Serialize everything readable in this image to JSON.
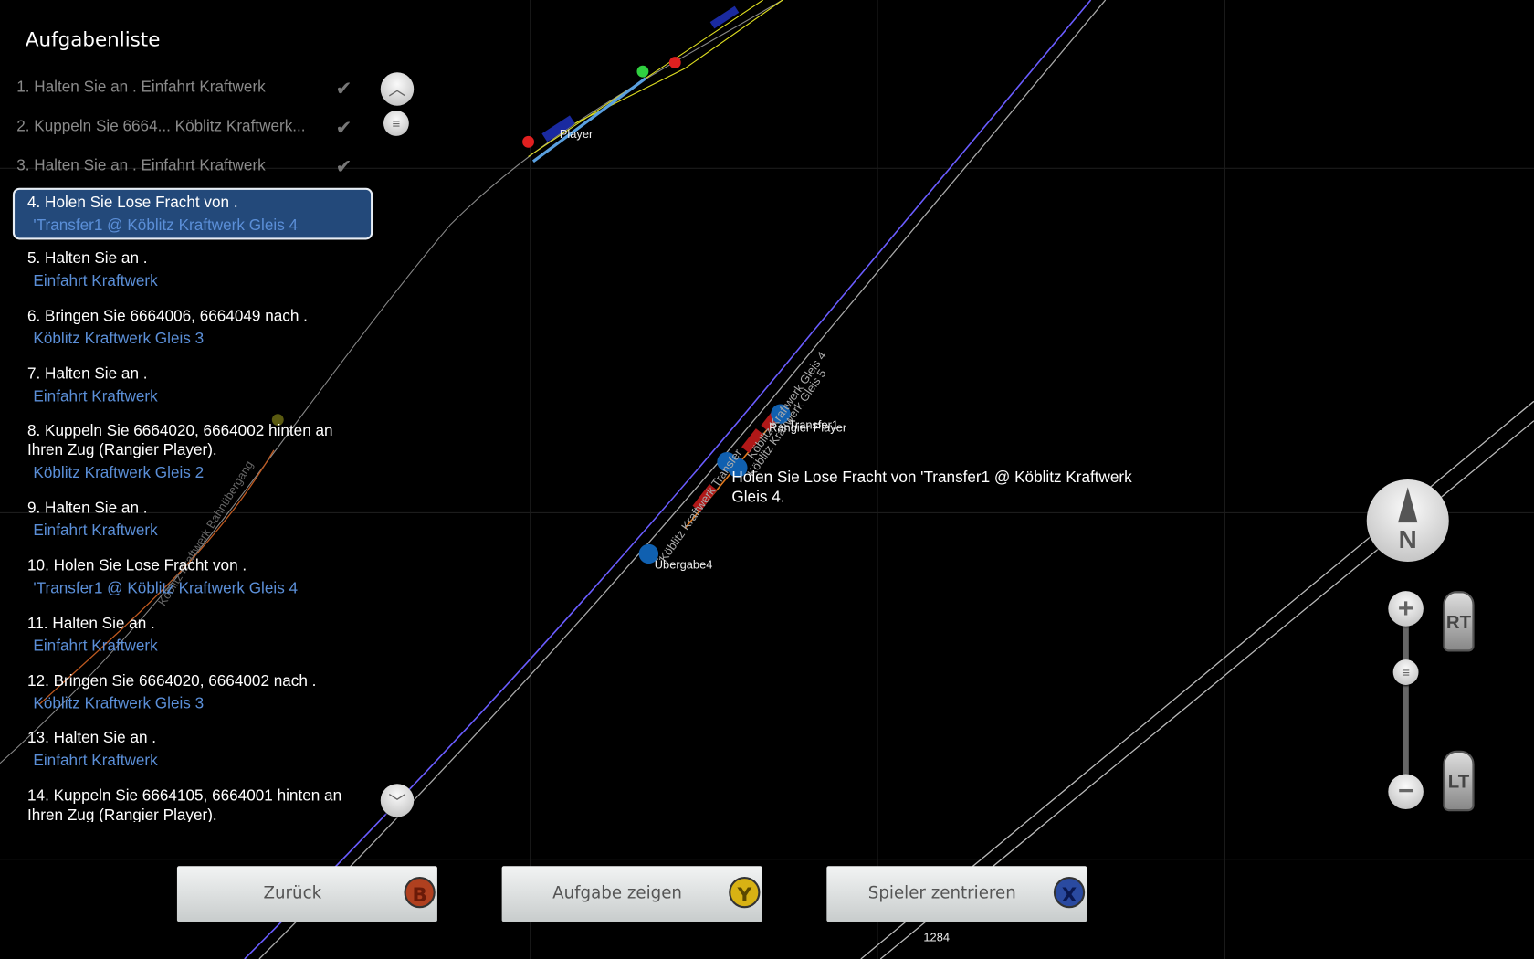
{
  "panel": {
    "title": "Aufgabenliste",
    "completed": [
      {
        "label": "1. Halten Sie an  . Einfahrt Kraftwerk"
      },
      {
        "label": "2. Kuppeln Sie 6664... Köblitz Kraftwerk..."
      },
      {
        "label": "3. Halten Sie an  . Einfahrt Kraftwerk"
      }
    ],
    "check_icon": "✔",
    "selected": {
      "label": "4. Holen Sie Lose Fracht von  .",
      "sub": "'Transfer1 @ Köblitz Kraftwerk Gleis 4"
    },
    "items": [
      {
        "label": "5. Halten Sie an  .",
        "sub": "Einfahrt Kraftwerk"
      },
      {
        "label": "6. Bringen Sie 6664006, 6664049 nach .",
        "sub": "Köblitz Kraftwerk Gleis 3"
      },
      {
        "label": "7. Halten Sie an  .",
        "sub": "Einfahrt Kraftwerk"
      },
      {
        "label": "8. Kuppeln Sie 6664020, 6664002 hinten an Ihren Zug (Rangier Player).",
        "sub": "Köblitz Kraftwerk Gleis 2"
      },
      {
        "label": "9. Halten Sie an  .",
        "sub": "Einfahrt Kraftwerk"
      },
      {
        "label": "10. Holen Sie Lose Fracht von  .",
        "sub": "'Transfer1 @ Köblitz Kraftwerk Gleis 4"
      },
      {
        "label": "11. Halten Sie an  .",
        "sub": "Einfahrt Kraftwerk"
      },
      {
        "label": "12. Bringen Sie 6664020, 6664002 nach .",
        "sub": "Köblitz Kraftwerk Gleis 3"
      },
      {
        "label": "13. Halten Sie an  .",
        "sub": "Einfahrt Kraftwerk"
      },
      {
        "label": "14. Kuppeln Sie 6664105, 6664001 hinten an Ihren Zug (Rangier Player)."
      }
    ]
  },
  "map": {
    "labels": {
      "player": "Player",
      "transfer": "Transfer1",
      "rangier": "Rangier Player",
      "uebergabe": "Übergabe4",
      "gleis4": "Köblitz Kraftwerk Gleis 4",
      "gleis5": "Köblitz Kraftwerk Gleis 5",
      "gleis_lower": "Köblitz Kraftwerk Transfer",
      "bahnuebergang": "Köblitz Kraftwerk Bahnübergang",
      "marker": "1284"
    },
    "task_text": "Holen Sie Lose Fracht von  'Transfer1 @ Köblitz Kraftwerk Gleis 4.",
    "compass_label": "N",
    "rt_label": "RT",
    "lt_label": "LT",
    "zoom_level": 0.4
  },
  "buttons": {
    "back": {
      "label": "Zurück",
      "key": "B",
      "color": "#b0401f"
    },
    "show": {
      "label": "Aufgabe zeigen",
      "key": "Y",
      "color": "#d8b214"
    },
    "center": {
      "label": "Spieler zentrieren",
      "key": "X",
      "color": "#2a4aa0"
    }
  }
}
